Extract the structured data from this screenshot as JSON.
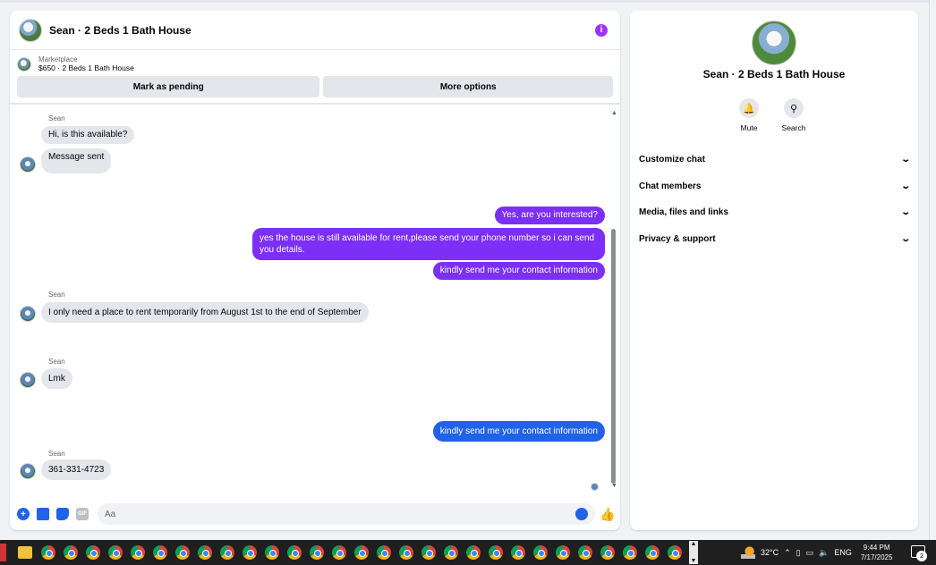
{
  "chat": {
    "title": "Sean · 2 Beds 1 Bath House",
    "info_icon": "i",
    "marketplace": {
      "label": "Marketplace",
      "listing": "$650 · 2 Beds 1 Bath House",
      "pending_button": "Mark as pending",
      "more_button": "More options"
    },
    "messages": [
      {
        "sender": "Sean",
        "text": "Hi, is this available?",
        "dir": "in"
      },
      {
        "text": "Message sent",
        "dir": "in"
      },
      {
        "text": "Yes, are you interested?",
        "dir": "out"
      },
      {
        "text": "yes the house is still available for rent,please send your phone number so i can send you details.",
        "dir": "out"
      },
      {
        "text": "kindly send me your contact information",
        "dir": "out"
      },
      {
        "sender": "Sean",
        "text": "I only need a place to rent temporarily from August 1st to the end of September",
        "dir": "in"
      },
      {
        "sender": "Sean",
        "text": "Lmk",
        "dir": "in"
      },
      {
        "text": "kindly send me your contact information",
        "dir": "out"
      },
      {
        "sender": "Sean",
        "text": "361-331-4723",
        "dir": "in"
      }
    ],
    "composer": {
      "placeholder": "Aa",
      "gif_label": "GIF",
      "like_icon": "thumbs-up-icon"
    }
  },
  "side": {
    "title": "Sean · 2 Beds 1 Bath House",
    "actions": [
      {
        "label": "Mute",
        "icon": "bell-icon"
      },
      {
        "label": "Search",
        "icon": "search-icon"
      }
    ],
    "sections": [
      {
        "label": "Customize chat"
      },
      {
        "label": "Chat members"
      },
      {
        "label": "Media, files and links"
      },
      {
        "label": "Privacy & support"
      }
    ]
  },
  "taskbar": {
    "temperature": "32°C",
    "language": "ENG",
    "time": "9:44 PM",
    "date": "7/17/2025",
    "notification_count": "2"
  },
  "colors": {
    "outgoing_purple": "#7b2ff7",
    "outgoing_blue": "#2163e8",
    "incoming": "#e4e6eb"
  }
}
